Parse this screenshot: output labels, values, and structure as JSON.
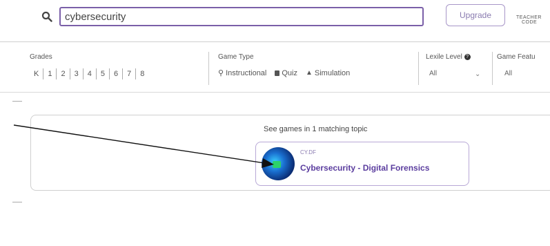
{
  "search": {
    "value": "cybersecurity"
  },
  "header": {
    "upgrade_label": "Upgrade",
    "teacher_line1": "TEACHER",
    "teacher_line2": "CODE"
  },
  "filters": {
    "grades_label": "Grades",
    "grades": [
      "K",
      "1",
      "2",
      "3",
      "4",
      "5",
      "6",
      "7",
      "8"
    ],
    "game_type_label": "Game Type",
    "game_types": [
      {
        "label": "Instructional",
        "icon": "lightbulb-icon"
      },
      {
        "label": "Quiz",
        "icon": "quiz-icon"
      },
      {
        "label": "Simulation",
        "icon": "simulation-icon"
      }
    ],
    "lexile_label": "Lexile Level",
    "lexile_value": "All",
    "game_features_label": "Game Featu",
    "game_features_value": "All"
  },
  "results": {
    "heading": "See games in 1 matching topic",
    "topic": {
      "code": "CY.DF",
      "title": "Cybersecurity - Digital Forensics"
    }
  },
  "colors": {
    "accent": "#7a5fa8",
    "topic_title": "#5a3c9e"
  }
}
